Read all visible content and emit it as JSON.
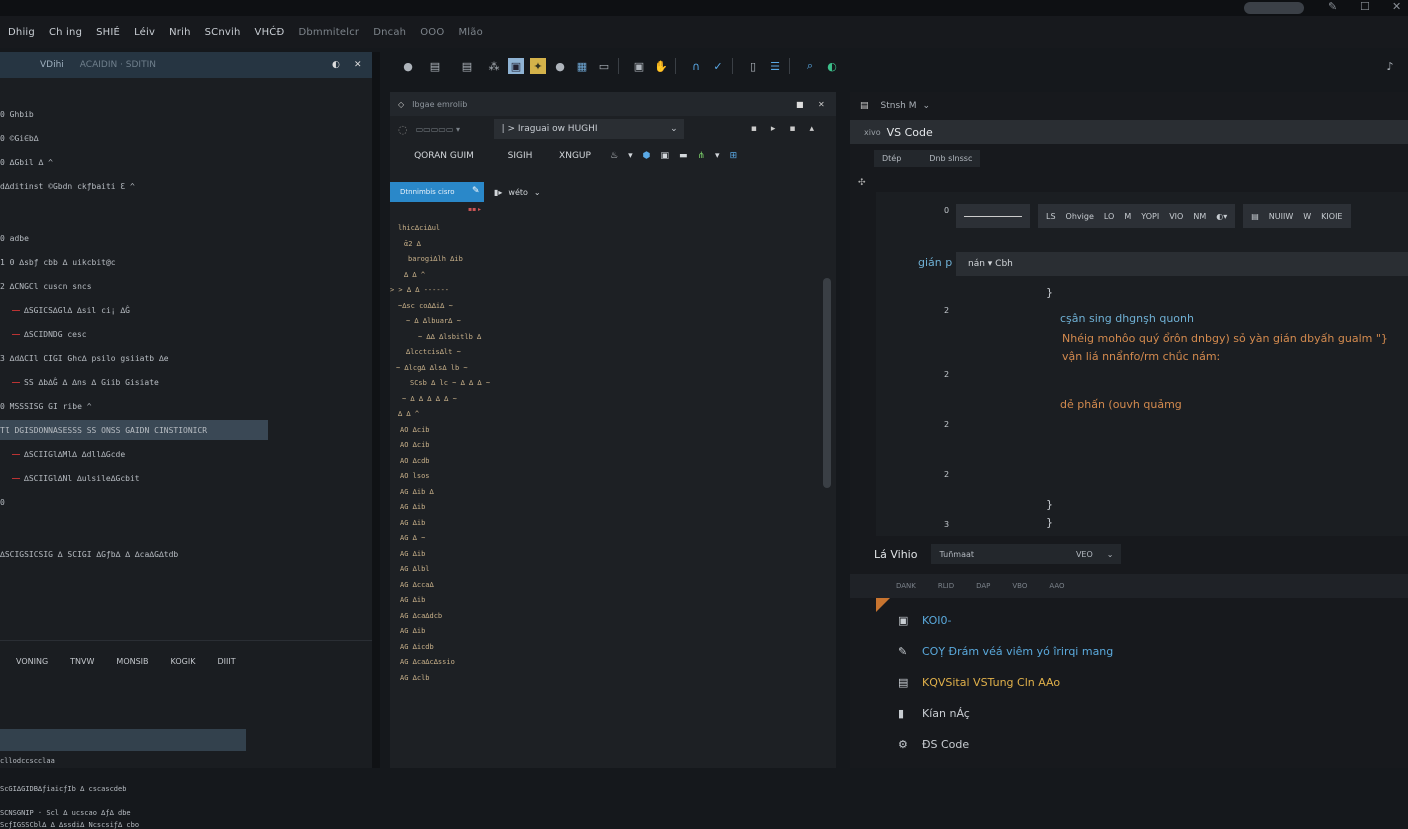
{
  "menu": [
    "Dhiig",
    "Ch ing",
    "SHIÉ",
    "Léiv",
    "Nrih",
    "SCnvih",
    "VHĆĐ",
    "Dbmmitelcr",
    "Dncah",
    "OOO",
    "Mlão"
  ],
  "left": {
    "header": [
      "VDihi",
      "ACAIDIN · SDITIN"
    ],
    "tree": [
      {
        "t": "0 Ghbib",
        "red": false
      },
      {
        "t": "0 ©Gi∈b∆",
        "red": false
      },
      {
        "t": "0 ∆Gbil ∆ ^",
        "red": false
      },
      {
        "t": "d∆ditinst ©Gbdn ckƒbaiti Ɛ ^",
        "red": false
      },
      {
        "t": "0 adbe",
        "red": false
      },
      {
        "t": "1 0 ∆sbƒ cbb ∆ uikcbit@c",
        "red": false
      },
      {
        "t": "2 ∆CNGCl cuscn sncs",
        "red": false
      },
      {
        "t": "∆SGICS∆Gl∆ ∆sil ci¡ ∆Ĝ",
        "red": true
      },
      {
        "t": "∆SCIDNDG cesc",
        "red": true
      },
      {
        "t": "3 ∆d∆CIl CIGI Ghc∆ psilo gsiiatb ∆e",
        "red": false
      },
      {
        "t": "SS ∆b∆Ĝ ∆ ∆ns ∆ Giib Gisiate",
        "red": true
      },
      {
        "t": "0 MSSSISG GI ribe ^",
        "red": false
      },
      {
        "t": "TƖ DGISDONNASESSS SS ONSS GAIDN CINSTIONICR",
        "red": false
      },
      {
        "t": "∆SCIIGl∆Ml∆ ∆dll∆Gcde",
        "red": true
      },
      {
        "t": "∆SCIIGl∆Nl ∆ulsile∆Gcbit",
        "red": true
      },
      {
        "t": "0",
        "red": false
      },
      {
        "t": "∆SCIGSICSIG ∆ SCIGI ∆Gƒb∆ ∆ ∆ca∆G∆tdb",
        "red": false
      }
    ],
    "bottom_tabs": [
      "VONING",
      "TNVW",
      "MONSIB",
      "KOGIK",
      "DIIIT"
    ],
    "bottom_lines": [
      "cllodccscclaa",
      "ScGI∆GIDB∆ƒiaicƒIb ∆ cscascdeb",
      "SCNSGNIP · Scl ∆ ucscao ∆ƒ∆ dbe",
      "ScƒIGSSCbl∆ ∆ ∆ssdi∆ Ncscsiƒ∆ cbo"
    ]
  },
  "mid": {
    "title": "Ibgae emrolib",
    "combo": "| > Iraguai ow HUGHI",
    "row3": [
      "QORAN GUIM",
      "SIGIH",
      "XNGUP"
    ],
    "blue_btn": "Dtnnimbis cisro",
    "toolbar2": "wéto",
    "lines": [
      "lhic∆ci∆ul",
      "ᾱ2 ∆",
      "barogi∆lh ∆ib",
      "∆ ∆ ^",
      "> > ∆ ∆ ------",
      "~∆sc co∆∆i∆ ~",
      "~ ∆ ∆lbuar∆ ~",
      "~ ∆∆ ∆lsbitlb ∆",
      "∆lcctcis∆lt ~",
      "~ ∆lcg∆ ∆ls∆ lb ~",
      "SCsb ∆ lc ~ ∆ ∆ ∆ ~",
      "~ ∆ ∆ ∆ ∆ ∆ ~",
      "∆ ∆ ^",
      "AO ∆cib",
      "AO ∆cib",
      "AO ∆cdb",
      "AO lsos",
      "AG ∆ib ∆",
      "AG ∆ib",
      "AG ∆ib",
      "AG ∆ ~",
      "AG ∆ib",
      "AG ∆lbl",
      "AG ∆cca∆",
      "AG ∆ib",
      "AG ∆ca∆dcb",
      "AG ∆ib",
      "AG ∆icdb",
      "AG ∆ca∆c∆ssio",
      "AG ∆clb"
    ]
  },
  "right": {
    "title": "Stnsh M",
    "vs_label": "VS Code",
    "prefix": "xivo",
    "sub": [
      "Dtép",
      "Dnb slnssc"
    ],
    "ed_tools_a": [
      "LS",
      "Ohvige",
      "LO",
      "M",
      "YOPI",
      "VIO",
      "NM"
    ],
    "ed_tools_b": [
      "NUIIW",
      "W",
      "KIOIE"
    ],
    "breadcrumb": "nán ▾ Cbh",
    "left_label": "gián p",
    "line_numbers": [
      "0",
      "2",
      "2",
      "2",
      "2",
      "3"
    ],
    "code": [
      {
        "t": "}",
        "c": "#c9cdd2"
      },
      {
        "t": "cşân sing dhgnşh quonh",
        "c": "#6fb0d4"
      },
      {
        "t": "Nhéig mohôo quý ổrôn dnbgy)  sỏ yàn gián dbyấh gualm \"}",
        "c": "#d38a4e"
      },
      {
        "t": "vận liá nnẩnfo∕rm chǘc nám:",
        "c": "#d38a4e"
      },
      {
        "t": "dẻ phấn (ouvh quảmg",
        "c": "#d38a4e"
      },
      {
        "t": "}",
        "c": "#c9cdd2"
      },
      {
        "t": "}",
        "c": "#c9cdd2"
      }
    ],
    "vbar_label": "Lá Vihio",
    "select_value": "Tuñmaat",
    "select_value2": "VEO",
    "columns": [
      "DANK",
      "RLID",
      "DAP",
      "VBO",
      "AAO"
    ],
    "items": [
      {
        "icon": "briefcase-icon",
        "t": "KOI0-",
        "c": "#5aa9dc"
      },
      {
        "icon": "wrench-icon",
        "t": "COỴ Đrám véá viêm yó îrirqi mang",
        "c": "#5aa9dc"
      },
      {
        "icon": "printer-icon",
        "t": "KQVSital VSTung Cln AAo",
        "c": "#e0b04a"
      },
      {
        "icon": "device-icon",
        "t": "Kían nÁç",
        "c": "#c9cdd2"
      },
      {
        "icon": "gear-icon",
        "t": "ĐS Code",
        "c": "#c9cdd2"
      }
    ]
  }
}
